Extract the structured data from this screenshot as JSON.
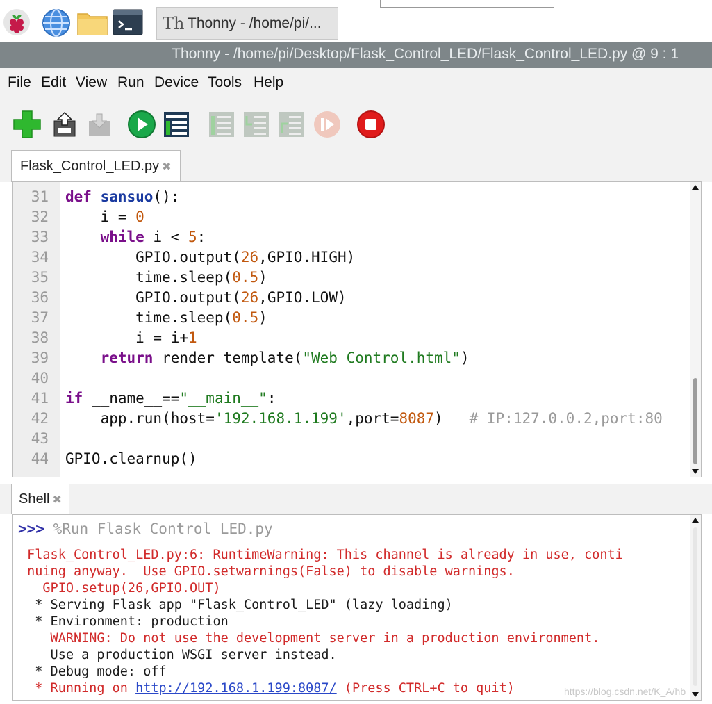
{
  "taskbar": {
    "icons": [
      "raspberry-pi-menu-icon",
      "web-browser-globe-icon",
      "file-manager-folder-icon",
      "terminal-icon"
    ],
    "task_icon": "Th",
    "task_title": "Thonny  -  /home/pi/..."
  },
  "window": {
    "title": "Thonny  -  /home/pi/Desktop/Flask_Control_LED/Flask_Control_LED.py  @  9 : 1"
  },
  "menu": [
    "File",
    "Edit",
    "View",
    "Run",
    "Device",
    "Tools",
    "Help"
  ],
  "toolbar": {
    "icons": [
      "new-file-icon",
      "load-file-icon",
      "save-file-icon",
      "run-icon",
      "debug-icon",
      "step-over-icon",
      "step-into-icon",
      "step-out-icon",
      "resume-icon",
      "stop-icon"
    ],
    "accent_colors": {
      "new": "#2fb82f",
      "run": "#1aa84a",
      "stop": "#e01b1b"
    }
  },
  "editor": {
    "tab_label": "Flask_Control_LED.py",
    "tab_close": "✖",
    "lines": [
      {
        "n": "31",
        "parts": [
          {
            "t": "def",
            "c": "kw"
          },
          {
            "t": " "
          },
          {
            "t": "sansuo",
            "c": "fn"
          },
          {
            "t": "():"
          }
        ]
      },
      {
        "n": "32",
        "parts": [
          {
            "t": "    i = "
          },
          {
            "t": "0",
            "c": "num"
          }
        ]
      },
      {
        "n": "33",
        "parts": [
          {
            "t": "    "
          },
          {
            "t": "while",
            "c": "kw"
          },
          {
            "t": " i < "
          },
          {
            "t": "5",
            "c": "num"
          },
          {
            "t": ":"
          }
        ]
      },
      {
        "n": "34",
        "parts": [
          {
            "t": "        GPIO.output("
          },
          {
            "t": "26",
            "c": "num"
          },
          {
            "t": ",GPIO.HIGH)"
          }
        ]
      },
      {
        "n": "35",
        "parts": [
          {
            "t": "        time.sleep("
          },
          {
            "t": "0.5",
            "c": "num"
          },
          {
            "t": ")"
          }
        ]
      },
      {
        "n": "36",
        "parts": [
          {
            "t": "        GPIO.output("
          },
          {
            "t": "26",
            "c": "num"
          },
          {
            "t": ",GPIO.LOW)"
          }
        ]
      },
      {
        "n": "37",
        "parts": [
          {
            "t": "        time.sleep("
          },
          {
            "t": "0.5",
            "c": "num"
          },
          {
            "t": ")"
          }
        ]
      },
      {
        "n": "38",
        "parts": [
          {
            "t": "        i = i+"
          },
          {
            "t": "1",
            "c": "num"
          }
        ]
      },
      {
        "n": "39",
        "parts": [
          {
            "t": "    "
          },
          {
            "t": "return",
            "c": "kw"
          },
          {
            "t": " render_template("
          },
          {
            "t": "\"Web_Control.html\"",
            "c": "str"
          },
          {
            "t": ")"
          }
        ]
      },
      {
        "n": "40",
        "parts": []
      },
      {
        "n": "41",
        "parts": [
          {
            "t": "if",
            "c": "kw"
          },
          {
            "t": " __name__=="
          },
          {
            "t": "\"__main__\"",
            "c": "str"
          },
          {
            "t": ":"
          }
        ]
      },
      {
        "n": "42",
        "parts": [
          {
            "t": "    app.run(host="
          },
          {
            "t": "'192.168.1.199'",
            "c": "str"
          },
          {
            "t": ",port="
          },
          {
            "t": "8087",
            "c": "num"
          },
          {
            "t": ")   "
          },
          {
            "t": "# IP:127.0.0.2,port:80",
            "c": "cm"
          }
        ]
      },
      {
        "n": "43",
        "parts": []
      },
      {
        "n": "44",
        "parts": [
          {
            "t": "GPIO.clearnup()"
          }
        ]
      }
    ]
  },
  "shell": {
    "tab_label": "Shell",
    "tab_close": "✖",
    "prompt": ">>>",
    "run_command": " %Run Flask_Control_LED.py",
    "lines": [
      {
        "parts": [
          {
            "t": " Flask_Control_LED.py:6: RuntimeWarning: This channel is already in use, conti",
            "c": "red"
          }
        ]
      },
      {
        "parts": [
          {
            "t": " nuing anyway.  Use GPIO.setwarnings(False) to disable warnings.",
            "c": "red"
          }
        ]
      },
      {
        "parts": [
          {
            "t": "   GPIO.setup(26,GPIO.OUT)",
            "c": "red"
          }
        ]
      },
      {
        "parts": [
          {
            "t": "  * Serving Flask app \"Flask_Control_LED\" (lazy loading)",
            "c": "dark"
          }
        ]
      },
      {
        "parts": [
          {
            "t": "  * Environment: production",
            "c": "dark"
          }
        ]
      },
      {
        "parts": [
          {
            "t": "    WARNING: Do not use the development server in a production environment.",
            "c": "red"
          }
        ]
      },
      {
        "parts": [
          {
            "t": "    Use a production WSGI server instead.",
            "c": "dark"
          }
        ]
      },
      {
        "parts": [
          {
            "t": "  * Debug mode: off",
            "c": "dark"
          }
        ]
      },
      {
        "parts": [
          {
            "t": "  * Running on ",
            "c": "red"
          },
          {
            "t": "http://192.168.1.199:8087/",
            "c": "link"
          },
          {
            "t": " (Press CTRL+C to quit)",
            "c": "red"
          }
        ]
      }
    ]
  },
  "watermark": "https://blog.csdn.net/K_A/hb"
}
